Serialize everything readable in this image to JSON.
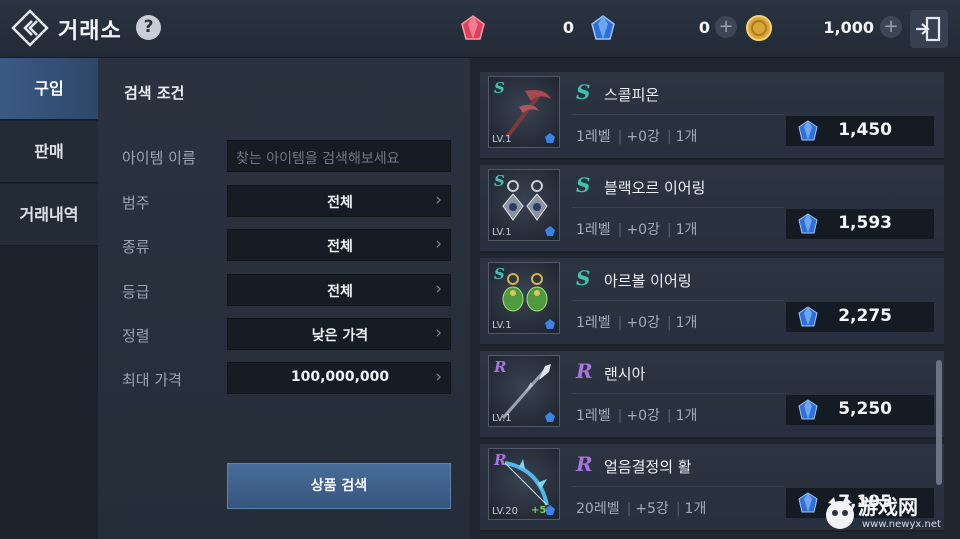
{
  "header": {
    "title": "거래소",
    "help": "?",
    "currencies": [
      {
        "name": "red-gem",
        "value": "0"
      },
      {
        "name": "blue-gem",
        "value": "0"
      },
      {
        "name": "gold-coin",
        "value": "1,000"
      }
    ],
    "plus": "+"
  },
  "tabs": [
    {
      "label": "구입",
      "active": true
    },
    {
      "label": "판매",
      "active": false
    },
    {
      "label": "거래내역",
      "active": false
    }
  ],
  "search": {
    "title": "검색 조건",
    "item_name_label": "아이템 이름",
    "item_name_placeholder": "찾는 아이템을 검색해보세요",
    "category_label": "범주",
    "category_value": "전체",
    "type_label": "종류",
    "type_value": "전체",
    "grade_label": "등급",
    "grade_value": "전체",
    "sort_label": "정렬",
    "sort_value": "낮은 가격",
    "maxprice_label": "최대 가격",
    "maxprice_value": "100,000,000",
    "button": "상품 검색"
  },
  "items": [
    {
      "grade": "S",
      "name": "스콜피온",
      "thumb_lv": "LV.1",
      "level": "1레벨",
      "enhance": "+0강",
      "count": "1개",
      "price": "1,450",
      "grade_color": "#3fc2b0"
    },
    {
      "grade": "S",
      "name": "블랙오르 이어링",
      "thumb_lv": "LV.1",
      "level": "1레벨",
      "enhance": "+0강",
      "count": "1개",
      "price": "1,593",
      "grade_color": "#3fc2b0"
    },
    {
      "grade": "S",
      "name": "아르볼 이어링",
      "thumb_lv": "LV.1",
      "level": "1레벨",
      "enhance": "+0강",
      "count": "1개",
      "price": "2,275",
      "grade_color": "#3fc2b0"
    },
    {
      "grade": "R",
      "name": "랜시아",
      "thumb_lv": "LV.1",
      "level": "1레벨",
      "enhance": "+0강",
      "count": "1개",
      "price": "5,250",
      "grade_color": "#a874e0"
    },
    {
      "grade": "R",
      "name": "얼음결정의 활",
      "thumb_lv": "LV.20",
      "thumb_enh": "+5",
      "level": "20레벨",
      "enhance": "+5강",
      "count": "1개",
      "price": "7,195",
      "grade_color": "#a874e0"
    }
  ],
  "watermark": {
    "text": "游戏网",
    "url": "www.newyx.net"
  }
}
